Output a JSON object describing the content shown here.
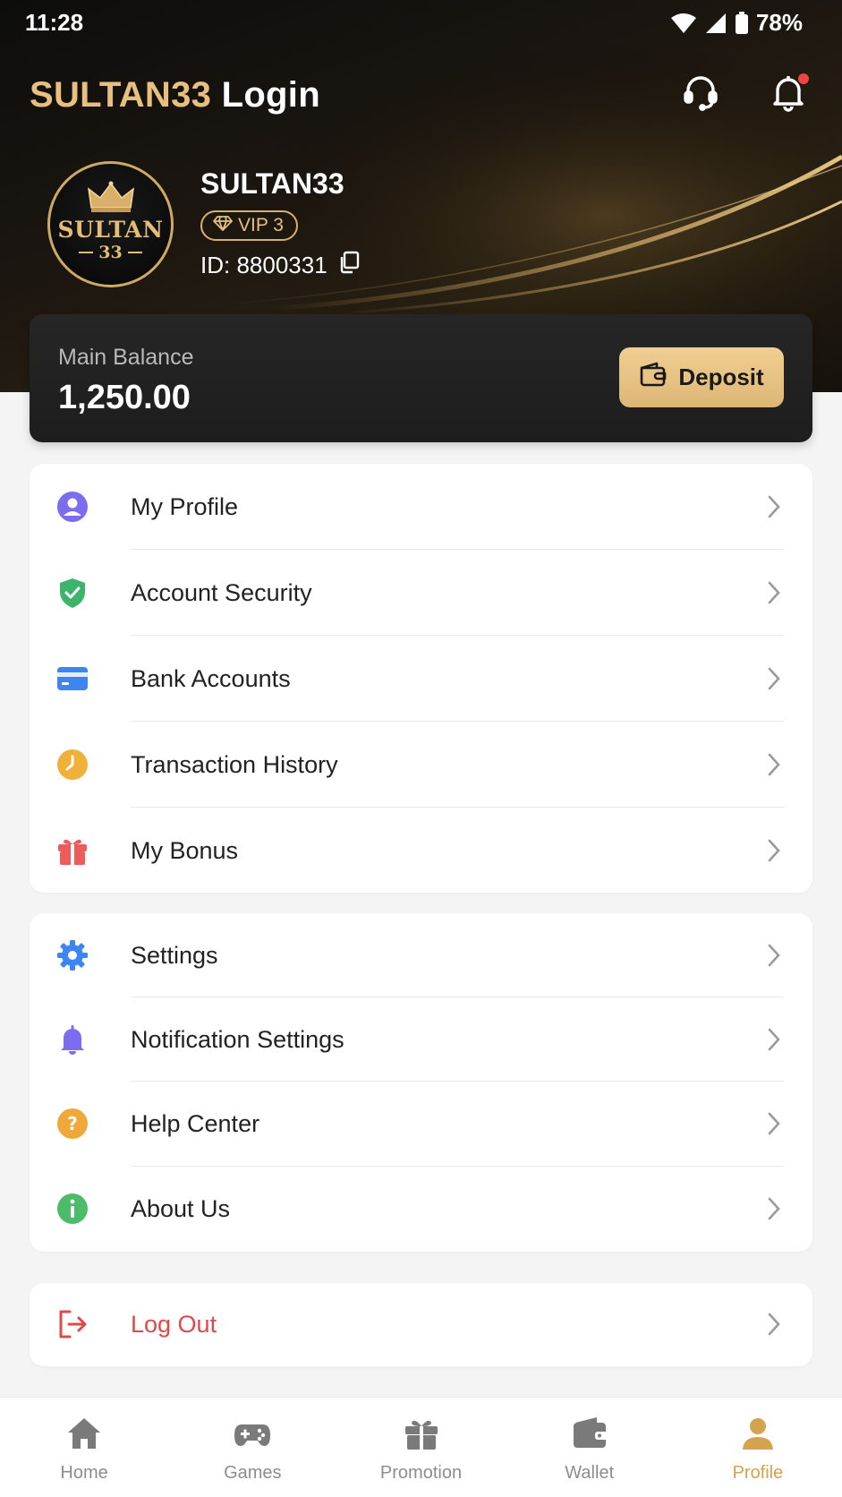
{
  "status_bar": {
    "time": "11:28",
    "battery": "78%"
  },
  "header": {
    "title_brand": "SULTAN33",
    "title_suffix": "Login",
    "support_icon": "headset-icon",
    "bell_icon": "bell-icon",
    "has_notification": true
  },
  "profile": {
    "avatar_text_top": "SULTAN",
    "avatar_text_bottom": "33",
    "username": "SULTAN33",
    "vip_label": "VIP 3",
    "id_text": "ID: 8800331"
  },
  "balance": {
    "label": "Main Balance",
    "value": "1,250.00",
    "deposit_label": "Deposit"
  },
  "menu_group_1": [
    {
      "label": "My Profile",
      "icon": "user-icon",
      "color": "#7c6cf0"
    },
    {
      "label": "Account Security",
      "icon": "shield-check-icon",
      "color": "#3fb36b"
    },
    {
      "label": "Bank Accounts",
      "icon": "credit-card-icon",
      "color": "#3d86f2"
    },
    {
      "label": "Transaction History",
      "icon": "clock-icon",
      "color": "#f0b13b"
    },
    {
      "label": "My Bonus",
      "icon": "gift-icon",
      "color": "#ee5b5b"
    }
  ],
  "menu_group_2": [
    {
      "label": "Settings",
      "icon": "gear-icon",
      "color": "#3d86f2"
    },
    {
      "label": "Notification Settings",
      "icon": "bell-icon",
      "color": "#7c6cf0"
    },
    {
      "label": "Help Center",
      "icon": "question-icon",
      "color": "#f0a83b"
    },
    {
      "label": "About Us",
      "icon": "info-icon",
      "color": "#4cbb6a"
    }
  ],
  "logout": {
    "label": "Log Out",
    "icon": "logout-icon",
    "color": "#e0484a"
  },
  "tabs": [
    {
      "label": "Home",
      "icon": "home-icon",
      "active": false
    },
    {
      "label": "Games",
      "icon": "gamepad-icon",
      "active": false
    },
    {
      "label": "Promotion",
      "icon": "gift-icon",
      "active": false
    },
    {
      "label": "Wallet",
      "icon": "wallet-icon",
      "active": false
    },
    {
      "label": "Profile",
      "icon": "person-icon",
      "active": true
    }
  ],
  "colors": {
    "gold": "#e7c07f",
    "active_tab": "#d4a34f",
    "danger": "#e0484a"
  }
}
